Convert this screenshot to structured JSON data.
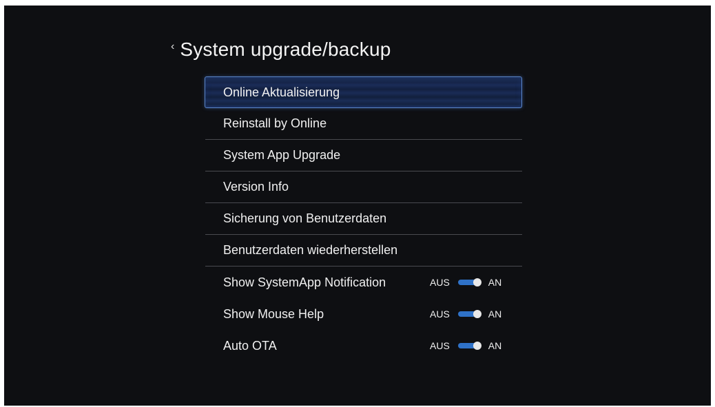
{
  "header": {
    "back_glyph": "‹",
    "title": "System upgrade/backup"
  },
  "menu": {
    "items": [
      {
        "label": "Online Aktualisierung",
        "focused": true
      },
      {
        "label": "Reinstall by Online"
      },
      {
        "label": "System App Upgrade"
      },
      {
        "label": "Version Info"
      },
      {
        "label": "Sicherung von Benutzerdaten"
      },
      {
        "label": "Benutzerdaten wiederherstellen"
      }
    ]
  },
  "toggles": [
    {
      "label": "Show SystemApp Notification",
      "off_label": "AUS",
      "on_label": "AN",
      "state": "on"
    },
    {
      "label": "Show Mouse Help",
      "off_label": "AUS",
      "on_label": "AN",
      "state": "on"
    },
    {
      "label": "Auto OTA",
      "off_label": "AUS",
      "on_label": "AN",
      "state": "on"
    }
  ],
  "colors": {
    "background": "#0e0f12",
    "focus_border": "#5b86c9",
    "toggle_track": "#2f72c8",
    "toggle_knob": "#e8e8e8"
  }
}
